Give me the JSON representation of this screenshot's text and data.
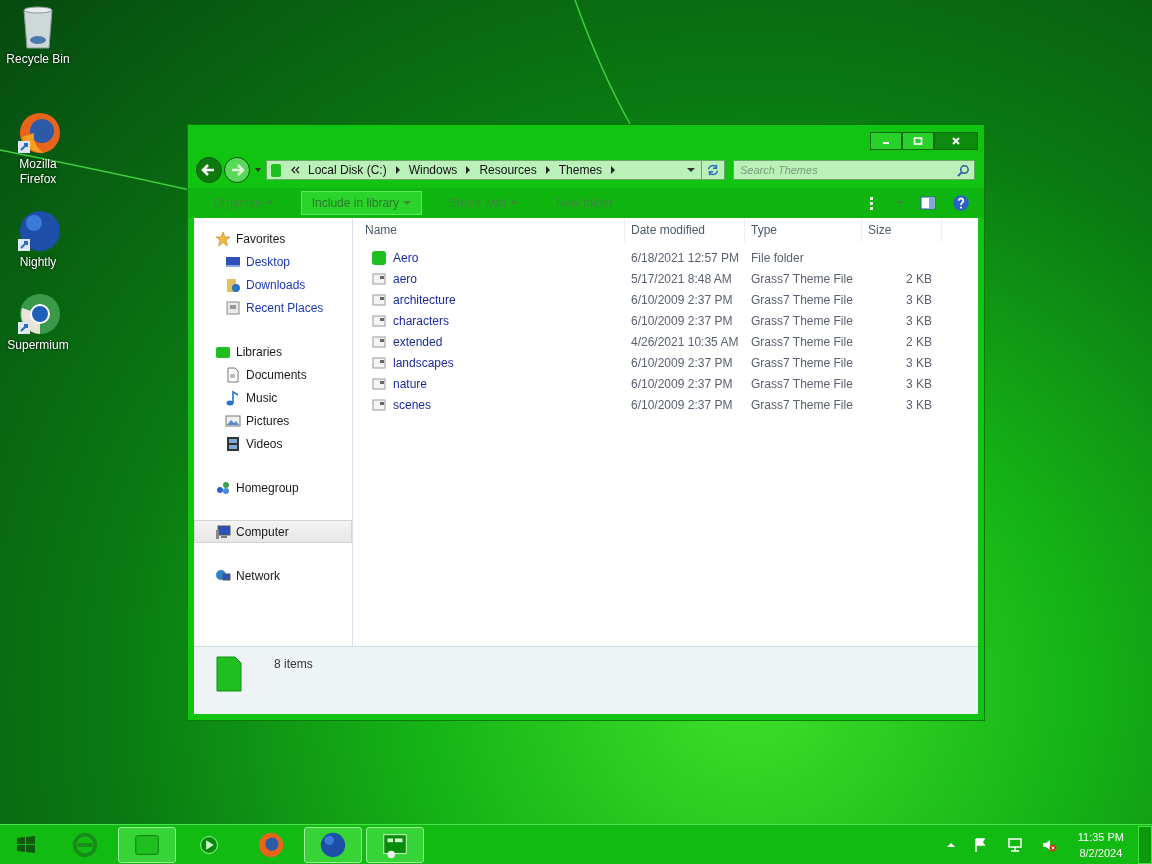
{
  "desktop_icons": [
    {
      "label": "Recycle Bin",
      "kind": "recycle"
    },
    {
      "label": "Mozilla Firefox",
      "kind": "firefox"
    },
    {
      "label": "Nightly",
      "kind": "nightly"
    },
    {
      "label": "Supermium",
      "kind": "supermium"
    }
  ],
  "window": {
    "breadcrumb": [
      "Local Disk (C:)",
      "Windows",
      "Resources",
      "Themes"
    ],
    "search": {
      "placeholder": "Search Themes"
    },
    "toolbar": [
      {
        "label": "Organize",
        "hovered": false
      },
      {
        "label": "Include in library",
        "hovered": true
      },
      {
        "label": "Share with",
        "hovered": false
      },
      {
        "label": "New folder",
        "hovered": false
      }
    ],
    "nav": [
      {
        "label": "Favorites",
        "selected": false,
        "children": [
          {
            "label": "Desktop",
            "selected": false
          },
          {
            "label": "Downloads",
            "selected": false
          },
          {
            "label": "Recent Places",
            "selected": false
          }
        ]
      },
      {
        "label": "Libraries",
        "selected": false,
        "children": [
          {
            "label": "Documents",
            "selected": false
          },
          {
            "label": "Music",
            "selected": false
          },
          {
            "label": "Pictures",
            "selected": false
          },
          {
            "label": "Videos",
            "selected": false
          }
        ]
      },
      {
        "label": "Homegroup",
        "selected": false
      },
      {
        "label": "Computer",
        "selected": true
      },
      {
        "label": "Network",
        "selected": false
      }
    ],
    "columns": [
      "Name",
      "Date modified",
      "Type",
      "Size"
    ],
    "rows": [
      {
        "name": "Aero",
        "date": "6/18/2021 12:57 PM",
        "type": "File folder",
        "kind": "folder"
      },
      {
        "name": "aero",
        "date": "5/17/2021 8:48 AM",
        "type": "Grass7 Theme File",
        "size": "2 KB",
        "kind": "theme"
      },
      {
        "name": "architecture",
        "date": "6/10/2009 2:37 PM",
        "type": "Grass7 Theme File",
        "size": "3 KB",
        "kind": "theme"
      },
      {
        "name": "characters",
        "date": "6/10/2009 2:37 PM",
        "type": "Grass7 Theme File",
        "size": "3 KB",
        "kind": "theme"
      },
      {
        "name": "extended",
        "date": "4/26/2021 10:35 AM",
        "type": "Grass7 Theme File",
        "size": "2 KB",
        "kind": "theme"
      },
      {
        "name": "landscapes",
        "date": "6/10/2009 2:37 PM",
        "type": "Grass7 Theme File",
        "size": "3 KB",
        "kind": "theme"
      },
      {
        "name": "nature",
        "date": "6/10/2009 2:37 PM",
        "type": "Grass7 Theme File",
        "size": "3 KB",
        "kind": "theme"
      },
      {
        "name": "scenes",
        "date": "6/10/2009 2:37 PM",
        "type": "Grass7 Theme File",
        "size": "3 KB",
        "kind": "theme"
      }
    ],
    "status": "8 items"
  },
  "taskbar": {
    "buttons": [
      {
        "kind": "ie",
        "active": false
      },
      {
        "kind": "explorer",
        "active": true
      },
      {
        "kind": "media",
        "active": false
      },
      {
        "kind": "firefox",
        "active": false
      },
      {
        "kind": "nightly",
        "active": true
      },
      {
        "kind": "panel",
        "active": true
      }
    ],
    "time": "11:35 PM",
    "date": "8/2/2024"
  }
}
